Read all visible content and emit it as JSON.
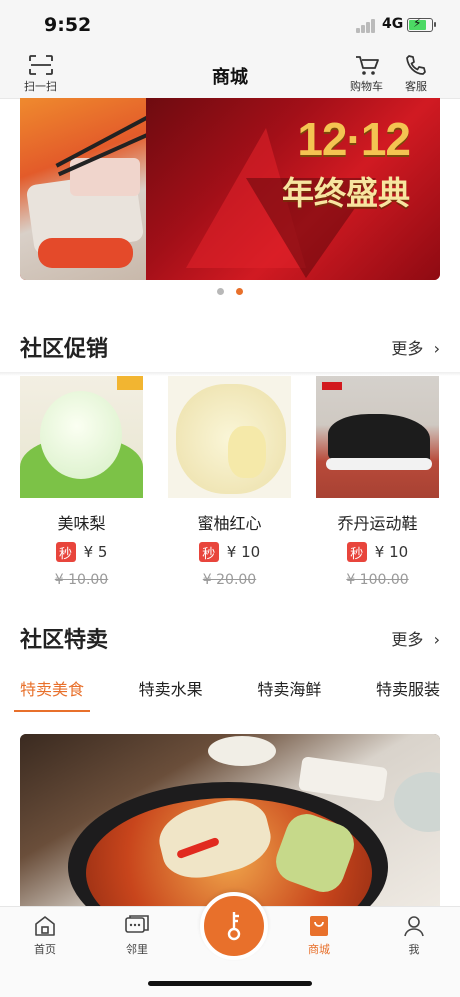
{
  "status": {
    "time": "9:52",
    "network": "4G"
  },
  "nav": {
    "title": "商城",
    "scan_label": "扫一扫",
    "cart_label": "购物车",
    "service_label": "客服"
  },
  "banner": {
    "big_text": "12·12",
    "sub_text": "年终盛典",
    "page_count": 2,
    "active_page": 2
  },
  "promo": {
    "title": "社区促销",
    "more_label": "更多",
    "miao_badge": "秒",
    "items": [
      {
        "name": "美味梨",
        "price": "¥ 5",
        "old_price": "¥ 10.00"
      },
      {
        "name": "蜜柚红心",
        "price": "¥ 10",
        "old_price": "¥ 20.00"
      },
      {
        "name": "乔丹运动鞋",
        "price": "¥ 10",
        "old_price": "¥ 100.00"
      }
    ]
  },
  "special": {
    "title": "社区特卖",
    "more_label": "更多",
    "tabs": [
      {
        "label": "特卖美食"
      },
      {
        "label": "特卖水果"
      },
      {
        "label": "特卖海鲜"
      },
      {
        "label": "特卖服装"
      }
    ],
    "active_tab": 0
  },
  "tabbar": {
    "home": "首页",
    "neighbors": "邻里",
    "mall": "商城",
    "me": "我"
  },
  "colors": {
    "accent": "#e8702b",
    "badge": "#e8453c",
    "status_bg": "#f6f6f6"
  },
  "icons": [
    "scan-icon",
    "cart-icon",
    "phone-icon",
    "chevron-right-icon",
    "home-icon",
    "chat-icon",
    "key-icon",
    "shopping-bag-icon",
    "user-icon"
  ]
}
